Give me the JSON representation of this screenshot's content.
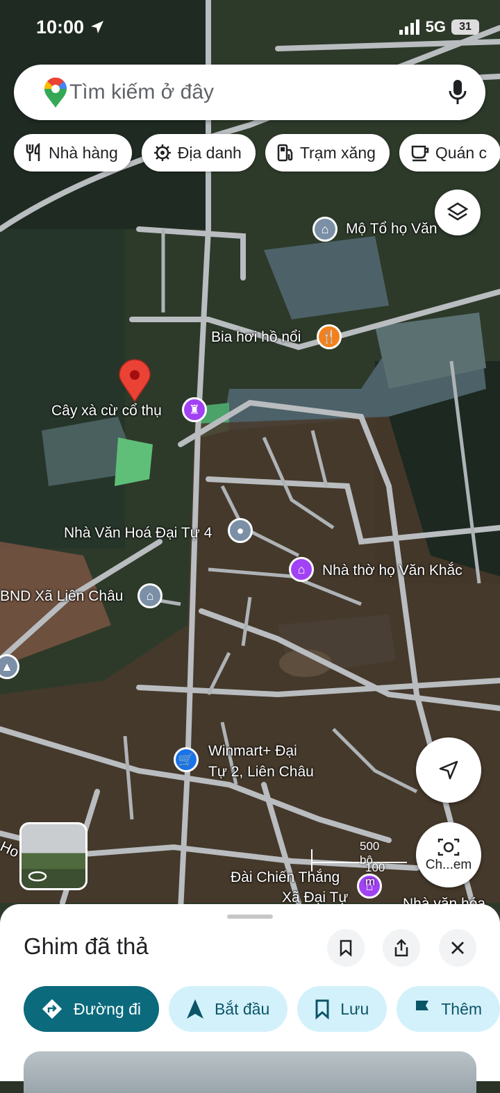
{
  "status_bar": {
    "time": "10:00",
    "network": "5G",
    "battery": "31"
  },
  "search": {
    "placeholder": "Tìm kiếm ở đây"
  },
  "chips": [
    {
      "label": "Nhà hàng",
      "icon": "restaurant-icon"
    },
    {
      "label": "Địa danh",
      "icon": "landmark-icon"
    },
    {
      "label": "Trạm xăng",
      "icon": "gas-station-icon"
    },
    {
      "label": "Quán c",
      "icon": "coffee-icon"
    }
  ],
  "map": {
    "labels": {
      "mo_to": "Mộ Tổ họ Văn",
      "bia_hoi": "Bia hơi hồ nổi",
      "cay_xa_cu": "Cây xà cừ cổ thụ",
      "nha_van_hoa": "Nhà Văn Hoá Đại Tự 4",
      "nha_tho": "Nhà thờ họ Văn Khắc",
      "ubnd": "BND Xã Liên Châu",
      "winmart_1": "Winmart+ Đại",
      "winmart_2": "Tự 2, Liên Châu",
      "dai_chien_thang_1": "Đài Chiến Thắng",
      "dai_chien_thang_2": "Xã Đại Tự",
      "nha_van_hoa_2": "Nhà văn hóa",
      "road_edge": "Ho"
    },
    "scale": {
      "imperial": "500 bộ",
      "metric": "100 m"
    },
    "camera_label": "Ch...em",
    "colors": {
      "restaurant": "#f2811d",
      "worship": "#a142f4",
      "civic": "#7b8fa6",
      "shopping": "#1a73e8",
      "pin": "#ea4335"
    }
  },
  "sheet": {
    "title": "Ghim đã thả",
    "actions": [
      {
        "label": "Đường đi",
        "icon": "directions-icon"
      },
      {
        "label": "Bắt đầu",
        "icon": "navigation-icon"
      },
      {
        "label": "Lưu",
        "icon": "bookmark-icon"
      },
      {
        "label": "Thêm",
        "icon": "flag-icon"
      }
    ]
  }
}
